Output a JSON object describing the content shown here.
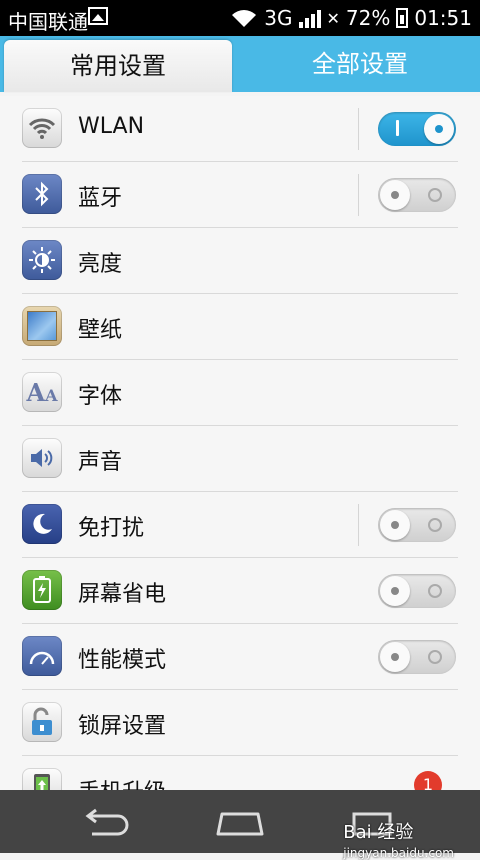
{
  "status": {
    "carrier": "中国联通",
    "network": "3G",
    "battery": "72%",
    "time": "01:51"
  },
  "tabs": [
    {
      "label": "常用设置",
      "active": true
    },
    {
      "label": "全部设置",
      "active": false
    }
  ],
  "items": [
    {
      "label": "WLAN",
      "icon": "wifi-icon",
      "toggle": true,
      "on": true
    },
    {
      "label": "蓝牙",
      "icon": "bluetooth-icon",
      "toggle": true,
      "on": false
    },
    {
      "label": "亮度",
      "icon": "brightness-icon"
    },
    {
      "label": "壁纸",
      "icon": "wallpaper-icon"
    },
    {
      "label": "字体",
      "icon": "font-icon"
    },
    {
      "label": "声音",
      "icon": "sound-icon"
    },
    {
      "label": "免打扰",
      "icon": "moon-icon",
      "toggle": true,
      "on": false
    },
    {
      "label": "屏幕省电",
      "icon": "battery-saver-icon",
      "toggle": true,
      "on": false
    },
    {
      "label": "性能模式",
      "icon": "speedometer-icon",
      "toggle": true,
      "on": false
    },
    {
      "label": "锁屏设置",
      "icon": "lock-icon"
    },
    {
      "label": "手机升级",
      "icon": "phone-update-icon",
      "badge": "1"
    }
  ],
  "watermark": {
    "brand": "Bai 经验",
    "url": "jingyan.baidu.com"
  }
}
